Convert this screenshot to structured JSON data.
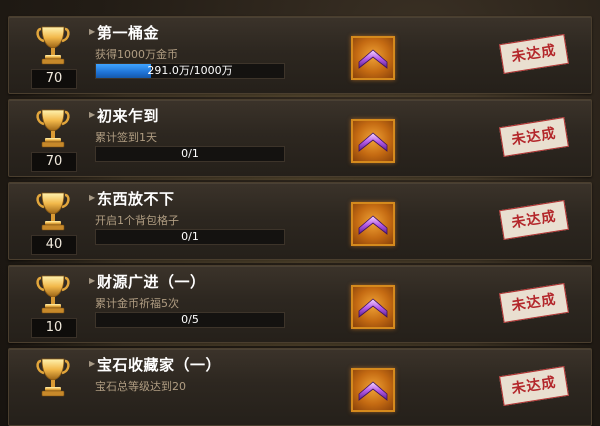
{
  "achievements": [
    {
      "title": "第一桶金",
      "description": "获得1000万金币",
      "points": "70",
      "progress_text": "291.0万/1000万",
      "progress_fraction": 0.291,
      "status": "未达成",
      "trophy": "gold-trophy-icon",
      "reward": "purple-chevron-gem-icon"
    },
    {
      "title": "初来乍到",
      "description": "累计签到1天",
      "points": "70",
      "progress_text": "0/1",
      "progress_fraction": 0,
      "status": "未达成",
      "trophy": "gold-trophy-icon",
      "reward": "purple-chevron-gem-icon"
    },
    {
      "title": "东西放不下",
      "description": "开启1个背包格子",
      "points": "40",
      "progress_text": "0/1",
      "progress_fraction": 0,
      "status": "未达成",
      "trophy": "gold-trophy-icon",
      "reward": "purple-chevron-gem-icon"
    },
    {
      "title": "财源广进（一）",
      "description": "累计金币祈福5次",
      "points": "10",
      "progress_text": "0/5",
      "progress_fraction": 0,
      "status": "未达成",
      "trophy": "gold-trophy-icon",
      "reward": "purple-chevron-gem-icon"
    },
    {
      "title": "宝石收藏家（一）",
      "description": "宝石总等级达到20",
      "points": "",
      "progress_text": "",
      "progress_fraction": null,
      "status": "未达成",
      "trophy": "gold-trophy-icon",
      "reward": "purple-chevron-gem-icon"
    }
  ],
  "colors": {
    "progress_fill": "#2a88ec",
    "reward_frame": "#d58a1d",
    "stamp_red": "#b3262a",
    "title_text": "#ffffff",
    "desc_text": "#b09d82"
  }
}
